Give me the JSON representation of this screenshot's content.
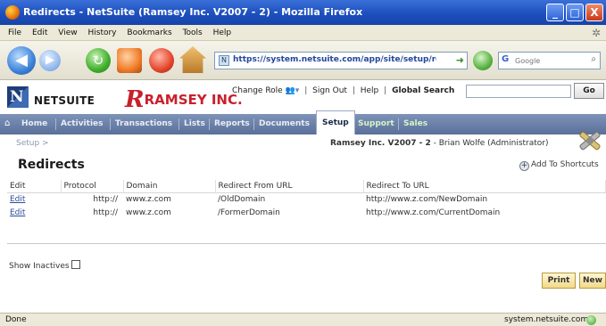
{
  "window": {
    "title": "Redirects - NetSuite (Ramsey Inc. V2007 - 2) - Mozilla Firefox",
    "minimize": "_",
    "maximize": "□",
    "close": "X"
  },
  "menu": [
    "File",
    "Edit",
    "View",
    "History",
    "Bookmarks",
    "Tools",
    "Help"
  ],
  "nav": {
    "url": "https://system.netsuite.com/app/site/setup/re",
    "search_placeholder": "Google"
  },
  "header": {
    "brand": "NETSUITE",
    "company_logo": "RAMSEY INC.",
    "change_role": "Change Role",
    "sign_out": "Sign Out",
    "help": "Help",
    "global_search_label": "Global Search",
    "global_search_value": "",
    "go": "Go"
  },
  "tabs": [
    {
      "label": "Home"
    },
    {
      "label": "Activities"
    },
    {
      "label": "Transactions"
    },
    {
      "label": "Lists"
    },
    {
      "label": "Reports"
    },
    {
      "label": "Documents"
    },
    {
      "label": "Setup",
      "active": true
    },
    {
      "label": "Support"
    },
    {
      "label": "Sales"
    }
  ],
  "crumb": "Setup >",
  "user": {
    "company": "Ramsey Inc. V2007 - 2",
    "name": " - Brian Wolfe (Administrator)"
  },
  "page": {
    "title": "Redirects",
    "add_shortcut": "Add To Shortcuts"
  },
  "table": {
    "headers": [
      "Edit",
      "Protocol",
      "Domain",
      "Redirect From URL",
      "Redirect To URL"
    ],
    "rows": [
      {
        "edit": "Edit",
        "protocol": "http://",
        "domain": "www.z.com",
        "from": "/OldDomain",
        "to": "http://www.z.com/NewDomain"
      },
      {
        "edit": "Edit",
        "protocol": "http://",
        "domain": "www.z.com",
        "from": "/FormerDomain",
        "to": "http://www.z.com/CurrentDomain"
      }
    ]
  },
  "show_inactives": "Show Inactives",
  "buttons": {
    "print": "Print",
    "new": "New"
  },
  "status": {
    "left": "Done",
    "right": "system.netsuite.com"
  }
}
